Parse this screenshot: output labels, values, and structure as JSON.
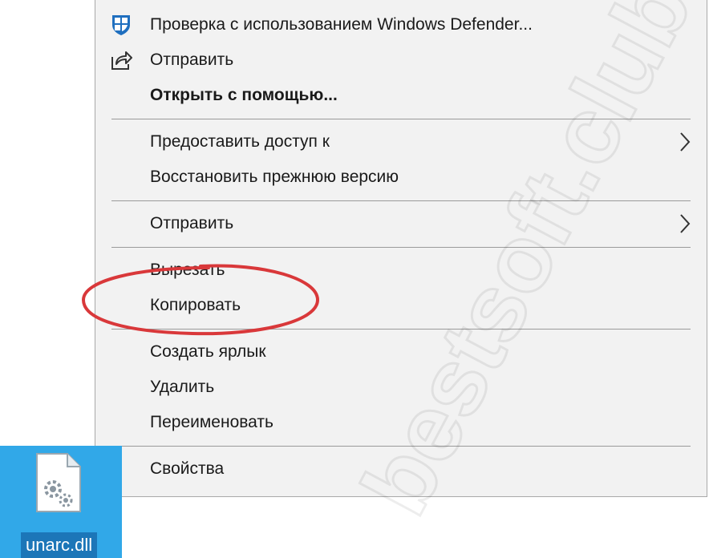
{
  "file": {
    "name": "unarc.dll",
    "icon": "dll-file-gear-icon"
  },
  "menu": {
    "items": [
      {
        "label": "Проверка с использованием Windows Defender...",
        "icon": "windows-defender-icon"
      },
      {
        "label": "Отправить",
        "icon": "share-icon"
      },
      {
        "label": "Открыть с помощью..."
      },
      {
        "label": "Предоставить доступ к",
        "submenu": true
      },
      {
        "label": "Восстановить прежнюю версию"
      },
      {
        "label": "Отправить",
        "submenu": true
      },
      {
        "label": "Вырезать"
      },
      {
        "label": "Копировать"
      },
      {
        "label": "Создать ярлык"
      },
      {
        "label": "Удалить"
      },
      {
        "label": "Переименовать"
      },
      {
        "label": "Свойства"
      }
    ]
  },
  "annotation": {
    "highlight_color": "#d9383a",
    "highlighted_item": "Копировать"
  },
  "colors": {
    "menu_background": "#f2f2f2",
    "selection_tile": "#31a8e8",
    "file_label_background": "#1c76b8",
    "defender_icon": "#1f6fbf"
  },
  "watermark": {
    "text": "bestsoft.club"
  }
}
